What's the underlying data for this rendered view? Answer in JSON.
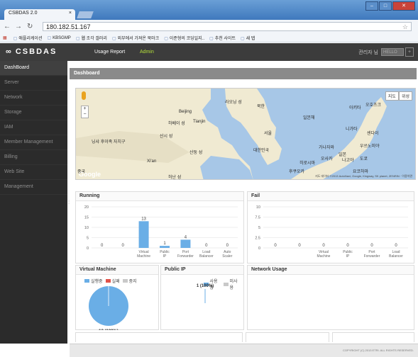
{
  "browser": {
    "tab_title": "CSBDAS 2.0",
    "tab_close": "×",
    "url": "180.182.51.167",
    "bookmarks": [
      {
        "label": "애플리케이션"
      },
      {
        "label": "KBSGMP"
      },
      {
        "label": "웹 조각 갤러리"
      },
      {
        "label": "외부에서 가져온 북마크"
      },
      {
        "label": "이준형의 코딩일지.."
      },
      {
        "label": "추천 사이트"
      },
      {
        "label": "새 탭"
      }
    ]
  },
  "app": {
    "logo": "CSBDAS",
    "menu": [
      {
        "label": "Usage Report",
        "color": "#ffffff"
      },
      {
        "label": "Admin",
        "color": "#b6e23a"
      }
    ],
    "user_label": "관리자 님",
    "user_select": "HELLO"
  },
  "sidebar": {
    "items": [
      {
        "label": "DashBoard",
        "active": true
      },
      {
        "label": "Server"
      },
      {
        "label": "Network"
      },
      {
        "label": "Storage"
      },
      {
        "label": "IAM"
      },
      {
        "label": "Member Management"
      },
      {
        "label": "Billing"
      },
      {
        "label": "Web Site"
      },
      {
        "label": "Management"
      }
    ]
  },
  "page": {
    "title": "Dashboard"
  },
  "map": {
    "map_type": [
      "지도",
      "위성"
    ],
    "labels": [
      {
        "text": "라오닝 성"
      },
      {
        "text": "Beijing"
      },
      {
        "text": "북한"
      },
      {
        "text": "하베이 성"
      },
      {
        "text": "Tianjin"
      },
      {
        "text": "서울"
      },
      {
        "text": "대한민국"
      },
      {
        "text": "산시 성"
      },
      {
        "text": "닝샤 후이족 자치구"
      },
      {
        "text": "산둥 성"
      },
      {
        "text": "중국"
      },
      {
        "text": "Xi'an"
      },
      {
        "text": "허난 성"
      },
      {
        "text": "일본"
      },
      {
        "text": "아키타"
      },
      {
        "text": "니가타"
      },
      {
        "text": "센다이"
      },
      {
        "text": "가나자와"
      },
      {
        "text": "오사카"
      },
      {
        "text": "나고야"
      },
      {
        "text": "도쿄"
      },
      {
        "text": "히로시마"
      },
      {
        "text": "후쿠오카"
      },
      {
        "text": "요코하마"
      },
      {
        "text": "일본해"
      },
      {
        "text": "오호츠크"
      },
      {
        "text": "우쓰노미야"
      }
    ],
    "attribution": "지도 데이터 ©2013 AutoNavi, Google, Kingway, SK planet, ZENRIN · 이용약관",
    "google": "Google"
  },
  "panels": {
    "running": {
      "title": "Running",
      "chart_data": {
        "type": "bar",
        "categories": [
          "",
          "",
          "Virtual Machine",
          "Public IP",
          "Port Forwarder",
          "Load Balancer",
          "Auto Scaler"
        ],
        "values": [
          0,
          0,
          13,
          1,
          4,
          0,
          0
        ],
        "ylim": [
          0,
          20
        ],
        "yticks": [
          0,
          5,
          10,
          15,
          20
        ],
        "color": "#6aaee6"
      }
    },
    "fail": {
      "title": "Fail",
      "chart_data": {
        "type": "bar",
        "categories": [
          "",
          "",
          "Virtual Machine",
          "Public IP",
          "Port Forwarder",
          "Load Balancer"
        ],
        "values": [
          0,
          0,
          0,
          0,
          0,
          0
        ],
        "ylim": [
          0,
          10
        ],
        "yticks": [
          "0",
          "2.5",
          "5",
          "7.5",
          "10"
        ],
        "color": "#6aaee6"
      }
    },
    "vm": {
      "title": "Virtual Machine",
      "legend": [
        {
          "label": "실행중",
          "color": "#6aaee6"
        },
        {
          "label": "실패",
          "color": "#e0524a"
        },
        {
          "label": "중지",
          "color": "#c9c9c9"
        }
      ],
      "chart_data": {
        "type": "pie",
        "slices": [
          {
            "name": "실행중",
            "value": 13,
            "color": "#6aaee6"
          }
        ],
        "label": "13 (100%)"
      }
    },
    "publicip": {
      "title": "Public IP",
      "legend": [
        {
          "label": "사용중",
          "color": "#6aaee6"
        },
        {
          "label": "미사용",
          "color": "#c9c9c9"
        }
      ],
      "chart_data": {
        "type": "pie",
        "slices": [
          {
            "name": "사용중",
            "value": 1,
            "color": "#6aaee6"
          }
        ],
        "label": "1 (100%)"
      }
    },
    "network": {
      "title": "Network Usage"
    }
  },
  "footer": {
    "text": "COPYRIGHT (C) 2013 ETRI. ALL RIGHTS RESERVED."
  }
}
